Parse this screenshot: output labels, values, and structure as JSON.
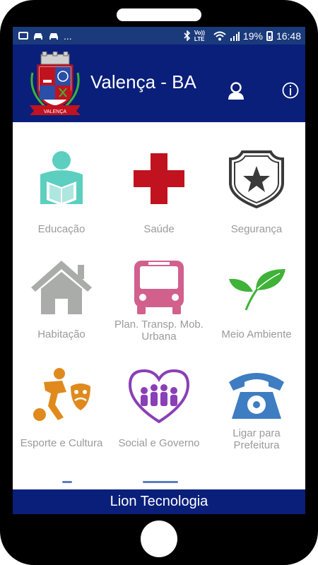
{
  "status_bar": {
    "battery": "19%",
    "time": "16:48",
    "network_label": "Vo)) LTE",
    "dots": "..."
  },
  "header": {
    "title": "Valença - BA",
    "crest_text": "VALENÇA"
  },
  "tiles": [
    {
      "label": "Educação",
      "icon": "reading-person-icon",
      "color": "#5ccfc0"
    },
    {
      "label": "Saúde",
      "icon": "red-cross-icon",
      "color": "#c1121f"
    },
    {
      "label": "Segurança",
      "icon": "police-badge-icon",
      "color": "#3a3a3a"
    },
    {
      "label": "Habitação",
      "icon": "house-icon",
      "color": "#a9aca9"
    },
    {
      "label": "Plan. Transp. Mob. Urbana",
      "icon": "bus-icon",
      "color": "#d1608d"
    },
    {
      "label": "Meio Ambiente",
      "icon": "leaf-icon",
      "color": "#3fb238"
    },
    {
      "label": "Esporte e Cultura",
      "icon": "sport-culture-icon",
      "color": "#e08a1e"
    },
    {
      "label": "Social e Governo",
      "icon": "people-heart-icon",
      "color": "#8a3fb6"
    },
    {
      "label": "Ligar para Prefeitura",
      "icon": "telephone-icon",
      "color": "#3e7dc2"
    }
  ],
  "footer": {
    "text": "Lion Tecnologia"
  },
  "colors": {
    "header": "#0a1f7a",
    "status_bar": "#1a3a7c",
    "label": "#9a9a9a"
  }
}
